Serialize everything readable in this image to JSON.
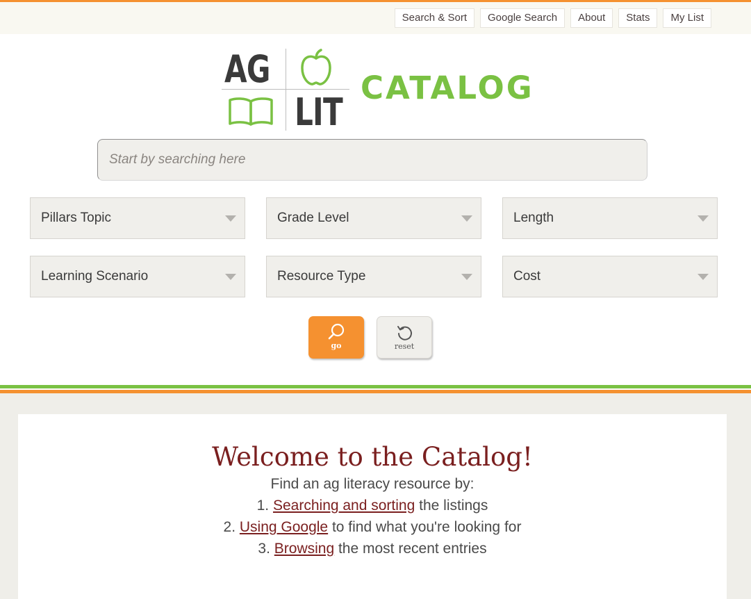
{
  "nav": {
    "items": [
      {
        "label": "Search & Sort"
      },
      {
        "label": "Google Search"
      },
      {
        "label": "About"
      },
      {
        "label": "Stats"
      },
      {
        "label": "My List"
      }
    ]
  },
  "logo": {
    "ag": "AG",
    "lit": "LIT",
    "catalog": "CATALOG",
    "brand_green": "#7ac143",
    "brand_dark": "#3a3a3a"
  },
  "search": {
    "value": "",
    "placeholder": "Start by searching here"
  },
  "filters": [
    {
      "label": "Pillars Topic"
    },
    {
      "label": "Grade Level"
    },
    {
      "label": "Length"
    },
    {
      "label": "Learning Scenario"
    },
    {
      "label": "Resource Type"
    },
    {
      "label": "Cost"
    }
  ],
  "buttons": {
    "go_label": "go",
    "reset_label": "reset",
    "go_color": "#f59130"
  },
  "welcome": {
    "title": "Welcome to the Catalog!",
    "intro": "Find an ag literacy resource by:",
    "items": [
      {
        "num": "1.",
        "link": "Searching and sorting",
        "rest": " the listings"
      },
      {
        "num": "2.",
        "link": "Using Google",
        "rest": " to find what you're looking for"
      },
      {
        "num": "3.",
        "link": "Browsing",
        "rest": " the most recent entries"
      }
    ],
    "title_color": "#7a1f1f"
  }
}
